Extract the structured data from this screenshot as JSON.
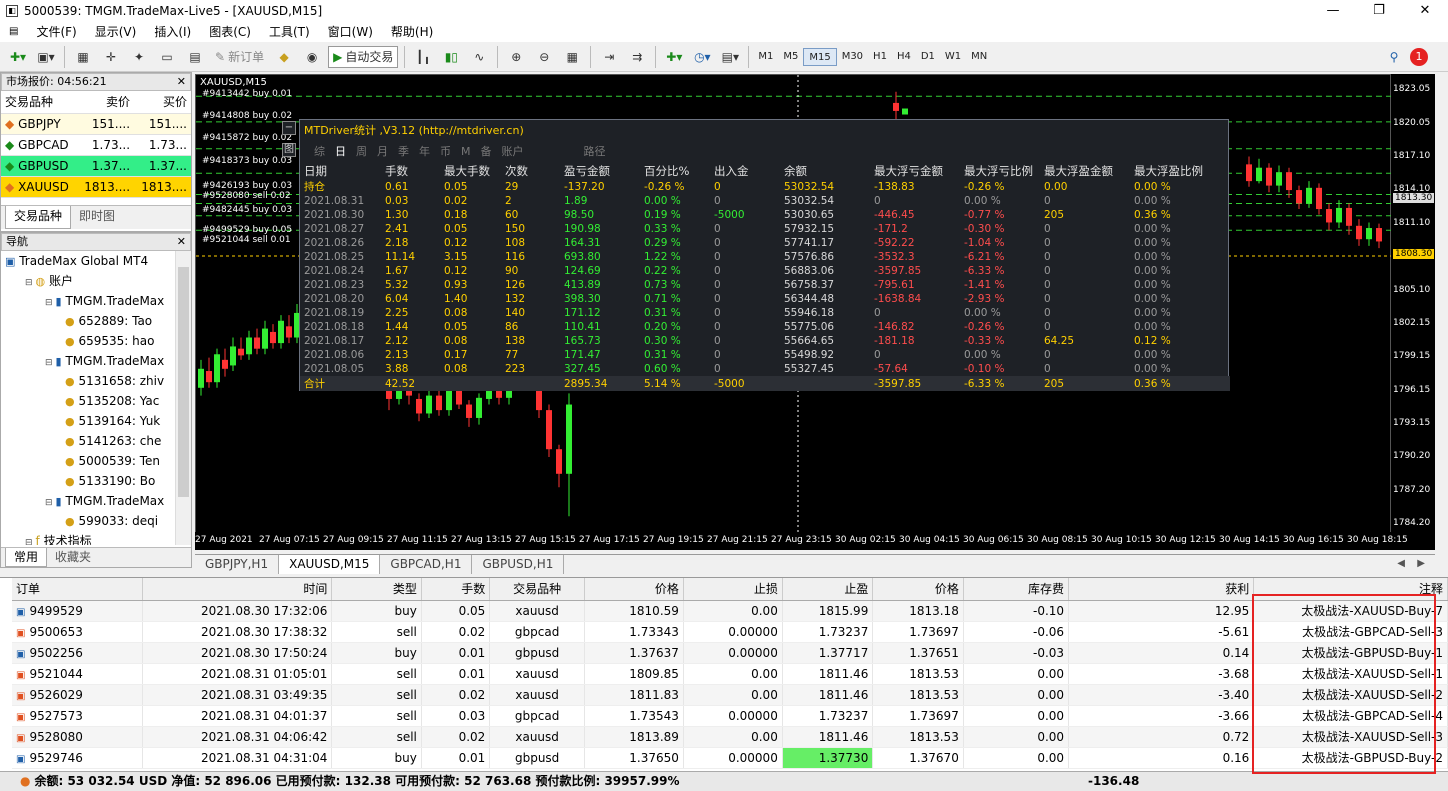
{
  "window": {
    "title": "5000539: TMGM.TradeMax-Live5 - [XAUUSD,M15]"
  },
  "menu": [
    "文件(F)",
    "显示(V)",
    "插入(I)",
    "图表(C)",
    "工具(T)",
    "窗口(W)",
    "帮助(H)"
  ],
  "toolbar": {
    "new_order": "新订单",
    "auto_trade": "自动交易",
    "timeframes": [
      "M1",
      "M5",
      "M15",
      "M30",
      "H1",
      "H4",
      "D1",
      "W1",
      "MN"
    ],
    "selected_tf": "M15"
  },
  "market_watch": {
    "title": "市场报价: 04:56:21",
    "headers": [
      "交易品种",
      "卖价",
      "买价"
    ],
    "rows": [
      {
        "symbol": "GBPJPY",
        "bid": "151....",
        "ask": "151....",
        "bg": "#fffbe0"
      },
      {
        "symbol": "GBPCAD",
        "bid": "1.73...",
        "ask": "1.73...",
        "bg": "#ffffff"
      },
      {
        "symbol": "GBPUSD",
        "bid": "1.37...",
        "ask": "1.37...",
        "bg": "#33ee88"
      },
      {
        "symbol": "XAUUSD",
        "bid": "1813....",
        "ask": "1813....",
        "bg": "#ffd400"
      }
    ],
    "tabs": [
      "交易品种",
      "即时图"
    ]
  },
  "navigator": {
    "title": "导航",
    "items": [
      {
        "text": "TradeMax Global MT4",
        "lvl": 0
      },
      {
        "text": "账户",
        "lvl": 1
      },
      {
        "text": "TMGM.TradeMax",
        "lvl": 2
      },
      {
        "text": "652889: Tao",
        "lvl": 3
      },
      {
        "text": "659535: hao",
        "lvl": 3
      },
      {
        "text": "TMGM.TradeMax",
        "lvl": 2
      },
      {
        "text": "5131658: zhiv",
        "lvl": 3
      },
      {
        "text": "5135208: Yac",
        "lvl": 3
      },
      {
        "text": "5139164: Yuk",
        "lvl": 3
      },
      {
        "text": "5141263: che",
        "lvl": 3
      },
      {
        "text": "5000539: Ten",
        "lvl": 3
      },
      {
        "text": "5133190: Bo",
        "lvl": 3
      },
      {
        "text": "TMGM.TradeMax",
        "lvl": 2
      },
      {
        "text": "599033: deqi",
        "lvl": 3
      },
      {
        "text": "技术指标",
        "lvl": 1
      }
    ],
    "tabs": [
      "常用",
      "收藏夹"
    ]
  },
  "chart": {
    "label": "XAUUSD,M15",
    "order_labels": [
      "#9413442 buy 0.01",
      "#9414808 buy 0.02",
      "#9415872 buy 0.02",
      "#9418373 buy 0.03",
      "#9426193 buy 0.03",
      "#9528080 sell 0.02",
      "#9482445 buy 0.03",
      "#9499529 buy 0.05",
      "#9521044 sell 0.01"
    ],
    "prices": [
      "1823.05",
      "1820.05",
      "1817.10",
      "1814.10",
      "1813.30",
      "1811.10",
      "1808.30",
      "1805.10",
      "1802.15",
      "1799.15",
      "1796.15",
      "1793.15",
      "1790.20",
      "1787.20",
      "1784.20"
    ],
    "times": [
      "27 Aug 2021",
      "27 Aug 07:15",
      "27 Aug 09:15",
      "27 Aug 11:15",
      "27 Aug 13:15",
      "27 Aug 15:15",
      "27 Aug 17:15",
      "27 Aug 19:15",
      "27 Aug 21:15",
      "27 Aug 23:15",
      "30 Aug 02:15",
      "30 Aug 04:15",
      "30 Aug 06:15",
      "30 Aug 08:15",
      "30 Aug 10:15",
      "30 Aug 12:15",
      "30 Aug 14:15",
      "30 Aug 16:15",
      "30 Aug 18:15"
    ],
    "tabs": [
      "GBPJPY,H1",
      "XAUUSD,M15",
      "GBPCAD,H1",
      "GBPUSD,H1"
    ],
    "selected_tab": "XAUUSD,M15"
  },
  "stats": {
    "title": "MTDriver统计 ,V3.12 (http://mtdriver.cn)",
    "tabs": [
      "综",
      "日",
      "周",
      "月",
      "季",
      "年",
      "币",
      "M",
      "备",
      "账户",
      "路径"
    ],
    "active_tab": "日",
    "headers": [
      "日期",
      "手数",
      "最大手数",
      "次数",
      "盈亏金额",
      "百分比%",
      "出入金",
      "余额",
      "最大浮亏金额",
      "最大浮亏比例",
      "最大浮盈金额",
      "最大浮盈比例"
    ],
    "hold": [
      "持仓",
      "0.61",
      "0.05",
      "29",
      "-137.20",
      "-0.26 %",
      "0",
      "53032.54",
      "-138.83",
      "-0.26 %",
      "0.00",
      "0.00 %"
    ],
    "rows": [
      [
        "2021.08.31",
        "0.03",
        "0.02",
        "2",
        "1.89",
        "0.00 %",
        "0",
        "53032.54",
        "0",
        "0.00 %",
        "0",
        "0.00 %"
      ],
      [
        "2021.08.30",
        "1.30",
        "0.18",
        "60",
        "98.50",
        "0.19 %",
        "-5000",
        "53030.65",
        "-446.45",
        "-0.77 %",
        "205",
        "0.36 %"
      ],
      [
        "2021.08.27",
        "2.41",
        "0.05",
        "150",
        "190.98",
        "0.33 %",
        "0",
        "57932.15",
        "-171.2",
        "-0.30 %",
        "0",
        "0.00 %"
      ],
      [
        "2021.08.26",
        "2.18",
        "0.12",
        "108",
        "164.31",
        "0.29 %",
        "0",
        "57741.17",
        "-592.22",
        "-1.04 %",
        "0",
        "0.00 %"
      ],
      [
        "2021.08.25",
        "11.14",
        "3.15",
        "116",
        "693.80",
        "1.22 %",
        "0",
        "57576.86",
        "-3532.3",
        "-6.21 %",
        "0",
        "0.00 %"
      ],
      [
        "2021.08.24",
        "1.67",
        "0.12",
        "90",
        "124.69",
        "0.22 %",
        "0",
        "56883.06",
        "-3597.85",
        "-6.33 %",
        "0",
        "0.00 %"
      ],
      [
        "2021.08.23",
        "5.32",
        "0.93",
        "126",
        "413.89",
        "0.73 %",
        "0",
        "56758.37",
        "-795.61",
        "-1.41 %",
        "0",
        "0.00 %"
      ],
      [
        "2021.08.20",
        "6.04",
        "1.40",
        "132",
        "398.30",
        "0.71 %",
        "0",
        "56344.48",
        "-1638.84",
        "-2.93 %",
        "0",
        "0.00 %"
      ],
      [
        "2021.08.19",
        "2.25",
        "0.08",
        "140",
        "171.12",
        "0.31 %",
        "0",
        "55946.18",
        "0",
        "0.00 %",
        "0",
        "0.00 %"
      ],
      [
        "2021.08.18",
        "1.44",
        "0.05",
        "86",
        "110.41",
        "0.20 %",
        "0",
        "55775.06",
        "-146.82",
        "-0.26 %",
        "0",
        "0.00 %"
      ],
      [
        "2021.08.17",
        "2.12",
        "0.08",
        "138",
        "165.73",
        "0.30 %",
        "0",
        "55664.65",
        "-181.18",
        "-0.33 %",
        "64.25",
        "0.12 %"
      ],
      [
        "2021.08.06",
        "2.13",
        "0.17",
        "77",
        "171.47",
        "0.31 %",
        "0",
        "55498.92",
        "0",
        "0.00 %",
        "0",
        "0.00 %"
      ],
      [
        "2021.08.05",
        "3.88",
        "0.08",
        "223",
        "327.45",
        "0.60 %",
        "0",
        "55327.45",
        "-57.64",
        "-0.10 %",
        "0",
        "0.00 %"
      ]
    ],
    "total": [
      "合计",
      "42.52",
      "",
      "",
      "2895.34",
      "5.14 %",
      "-5000",
      "",
      "-3597.85",
      "-6.33 %",
      "205",
      "0.36 %"
    ]
  },
  "terminal": {
    "headers": [
      "订单",
      "时间",
      "类型",
      "手数",
      "交易品种",
      "价格",
      "止损",
      "止盈",
      "价格",
      "库存费",
      "获利",
      "注释"
    ],
    "rows": [
      [
        "9499529",
        "2021.08.30 17:32:06",
        "buy",
        "0.05",
        "xauusd",
        "1810.59",
        "0.00",
        "1815.99",
        "1813.18",
        "-0.10",
        "12.95",
        "太极战法-XAUUSD-Buy-7"
      ],
      [
        "9500653",
        "2021.08.30 17:38:32",
        "sell",
        "0.02",
        "gbpcad",
        "1.73343",
        "0.00000",
        "1.73237",
        "1.73697",
        "-0.06",
        "-5.61",
        "太极战法-GBPCAD-Sell-3"
      ],
      [
        "9502256",
        "2021.08.30 17:50:24",
        "buy",
        "0.01",
        "gbpusd",
        "1.37637",
        "0.00000",
        "1.37717",
        "1.37651",
        "-0.03",
        "0.14",
        "太极战法-GBPUSD-Buy-1"
      ],
      [
        "9521044",
        "2021.08.31 01:05:01",
        "sell",
        "0.01",
        "xauusd",
        "1809.85",
        "0.00",
        "1811.46",
        "1813.53",
        "0.00",
        "-3.68",
        "太极战法-XAUUSD-Sell-1"
      ],
      [
        "9526029",
        "2021.08.31 03:49:35",
        "sell",
        "0.02",
        "xauusd",
        "1811.83",
        "0.00",
        "1811.46",
        "1813.53",
        "0.00",
        "-3.40",
        "太极战法-XAUUSD-Sell-2"
      ],
      [
        "9527573",
        "2021.08.31 04:01:37",
        "sell",
        "0.03",
        "gbpcad",
        "1.73543",
        "0.00000",
        "1.73237",
        "1.73697",
        "0.00",
        "-3.66",
        "太极战法-GBPCAD-Sell-4"
      ],
      [
        "9528080",
        "2021.08.31 04:06:42",
        "sell",
        "0.02",
        "xauusd",
        "1813.89",
        "0.00",
        "1811.46",
        "1813.53",
        "0.00",
        "0.72",
        "太极战法-XAUUSD-Sell-3"
      ],
      [
        "9529746",
        "2021.08.31 04:31:04",
        "buy",
        "0.01",
        "gbpusd",
        "1.37650",
        "0.00000",
        "1.37730",
        "1.37670",
        "0.00",
        "0.16",
        "太极战法-GBPUSD-Buy-2"
      ]
    ],
    "highlight_tp_rows": [
      2,
      7
    ],
    "balance_line": "余额: 53 032.54 USD  净值: 52 896.06  已用预付款: 132.38  可用预付款: 52 763.68  预付款比例: 39957.99%",
    "balance_profit": "-136.48"
  }
}
